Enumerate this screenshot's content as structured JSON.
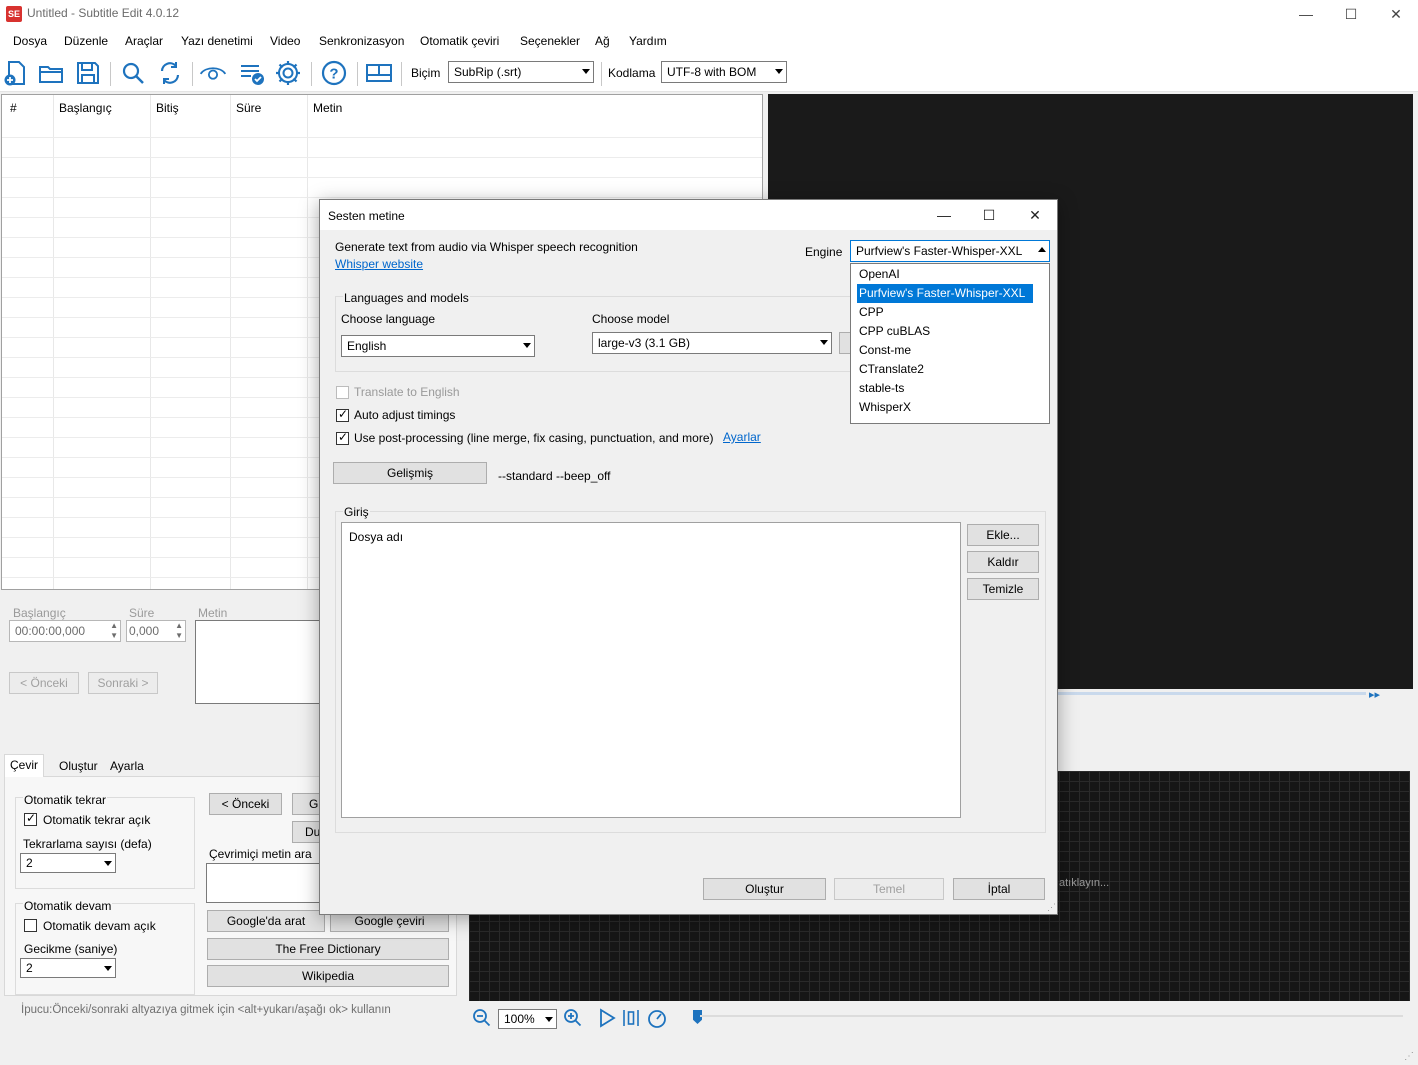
{
  "window": {
    "title": "Untitled - Subtitle Edit 4.0.12",
    "icon_text": "SE",
    "min": "—",
    "max": "☐",
    "close": "✕"
  },
  "menu": [
    "Dosya",
    "Düzenle",
    "Araçlar",
    "Yazı denetimi",
    "Video",
    "Senkronizasyon",
    "Otomatik çeviri",
    "Seçenekler",
    "Ağ",
    "Yardım"
  ],
  "toolbar": {
    "format_label": "Biçim",
    "format_value": "SubRip (.srt)",
    "encoding_label": "Kodlama",
    "encoding_value": "UTF-8 with BOM"
  },
  "grid": {
    "columns": [
      "#",
      "Başlangıç",
      "Bitiş",
      "Süre",
      "Metin"
    ]
  },
  "editor": {
    "start_label": "Başlangıç",
    "start_value": "00:00:00,000",
    "duration_label": "Süre",
    "duration_value": "0,000",
    "text_label": "Metin",
    "prev_button": "< Önceki",
    "next_button": "Sonraki >"
  },
  "tabs": [
    "Çevir",
    "Oluştur",
    "Ayarla"
  ],
  "translate_panel": {
    "auto_repeat_group": "Otomatik tekrar",
    "auto_repeat_on": "Otomatik tekrar açık",
    "repeat_count_label": "Tekrarlama sayısı (defa)",
    "repeat_count_value": "2",
    "auto_continue_group": "Otomatik devam",
    "auto_continue_on": "Otomatik devam açık",
    "delay_label": "Gecikme (saniye)",
    "delay_value": "2",
    "prev_button": "< Önceki",
    "go_button_partial": "Gi",
    "du_button_partial": "Du",
    "online_search_label": "Çevrimiçi metin ara",
    "google_search": "Google'da arat",
    "google_translate": "Google çeviri",
    "free_dictionary": "The Free Dictionary",
    "wikipedia": "Wikipedia",
    "tip": "İpucu:Önceki/sonraki altyazıya gitmek için <alt+yukarı/aşağı ok> kullanın"
  },
  "video": {
    "waveform_hint_partial": "atıklayın...",
    "zoom_value": "100%"
  },
  "dialog": {
    "title": "Sesten metine",
    "description": "Generate text from audio via Whisper speech recognition",
    "website_link": "Whisper website",
    "engine_label": "Engine",
    "engine_value": "Purfview's Faster-Whisper-XXL",
    "engine_options": [
      "OpenAI",
      "Purfview's Faster-Whisper-XXL",
      "CPP",
      "CPP cuBLAS",
      "Const-me",
      "CTranslate2",
      "stable-ts",
      "WhisperX"
    ],
    "engine_selected_index": 1,
    "languages_group": "Languages and models",
    "choose_language_label": "Choose language",
    "language_value": "English",
    "choose_model_label": "Choose model",
    "model_value": "large-v3 (3.1 GB)",
    "translate_to_english": "Translate to English",
    "auto_adjust": "Auto adjust timings",
    "post_processing": "Use post-processing (line merge, fix casing, punctuation, and more)",
    "settings_link": "Ayarlar",
    "advanced_button": "Gelişmiş",
    "advanced_params": "--standard --beep_off",
    "input_group": "Giriş",
    "file_name_header": "Dosya adı",
    "add_button": "Ekle...",
    "remove_button": "Kaldır",
    "clear_button": "Temizle",
    "generate_button": "Oluştur",
    "basic_button": "Temel",
    "cancel_button": "İptal"
  }
}
